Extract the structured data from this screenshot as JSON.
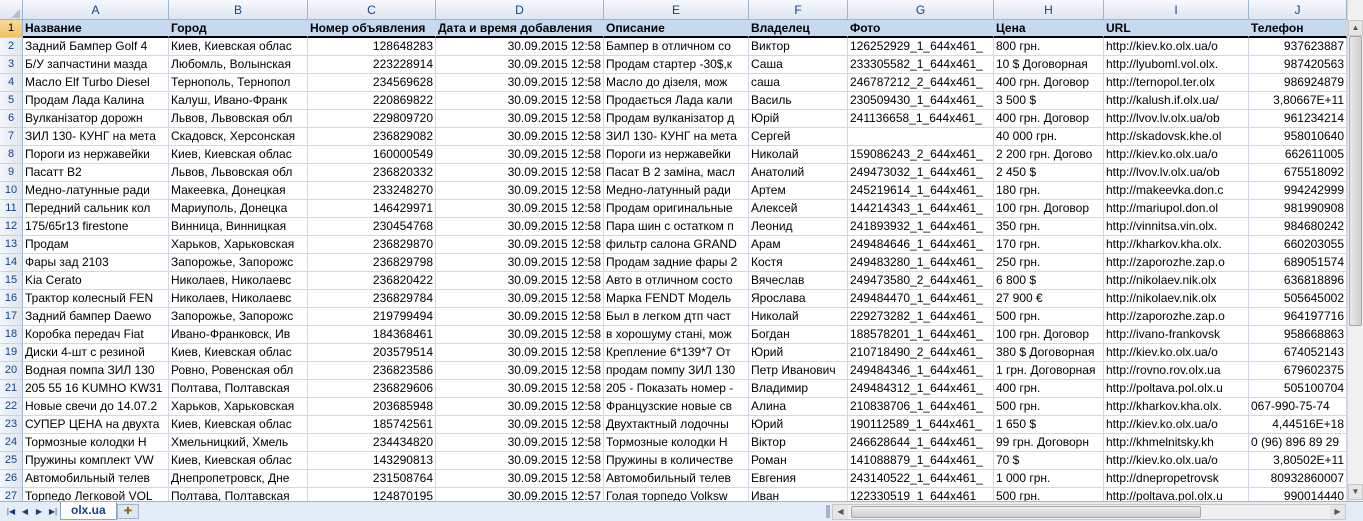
{
  "columns": [
    "A",
    "B",
    "C",
    "D",
    "E",
    "F",
    "G",
    "H",
    "I",
    "J"
  ],
  "headers": [
    "Название",
    "Город",
    "Номер объявления",
    "Дата и время добавления",
    "Описание",
    "Владелец",
    "Фото",
    "Цена",
    "URL",
    "Телефон"
  ],
  "rows": [
    {
      "n": "2",
      "c": [
        "Задний Бампер Golf 4",
        "Киев, Киевская облас",
        "128648283",
        "30.09.2015 12:58",
        "Бампер в отличном со",
        "Виктор",
        "126252929_1_644x461_",
        "800 грн.",
        "http://kiev.ko.olx.ua/o",
        "937623887"
      ]
    },
    {
      "n": "3",
      "c": [
        "Б/У запчастини мазда",
        "Любомль, Волынская",
        "223228914",
        "30.09.2015 12:58",
        "Продам стартер -30$,к",
        "Саша",
        "233305582_1_644x461_",
        "10 $ Договорная",
        "http://lyuboml.vol.olx.",
        "987420563"
      ]
    },
    {
      "n": "4",
      "c": [
        "Масло Elf Turbo Diesel",
        "Тернополь, Тернопол",
        "234569628",
        "30.09.2015 12:58",
        "Масло до дізеля, мож",
        "саша",
        "246787212_2_644x461_",
        "400 грн. Договор",
        "http://ternopol.ter.olx",
        "986924879"
      ]
    },
    {
      "n": "5",
      "c": [
        "Продам Лада Калина",
        "Калуш, Ивано-Франк",
        "220869822",
        "30.09.2015 12:58",
        "Продається Лада кали",
        "Василь",
        "230509430_1_644x461_",
        "3 500 $",
        "http://kalush.if.olx.ua/",
        "3,80667E+11"
      ]
    },
    {
      "n": "6",
      "c": [
        "Вулканізатор дорожн",
        "Львов, Львовская обл",
        "229809720",
        "30.09.2015 12:58",
        "Продам вулканізатор д",
        "Юрій",
        "241136658_1_644x461_",
        "400 грн. Договор",
        "http://lvov.lv.olx.ua/ob",
        "961234214"
      ]
    },
    {
      "n": "7",
      "c": [
        "ЗИЛ 130- КУНГ на мета",
        "Скадовск, Херсонская",
        "236829082",
        "30.09.2015 12:58",
        "ЗИЛ 130- КУНГ на мета",
        "Сергей",
        "",
        "40 000 грн.",
        "http://skadovsk.khe.ol",
        "958010640"
      ]
    },
    {
      "n": "8",
      "c": [
        "Пороги из нержавейки",
        "Киев, Киевская облас",
        "160000549",
        "30.09.2015 12:58",
        "Пороги из нержавейки",
        "Николай",
        "159086243_2_644x461_",
        "2 200 грн. Догово",
        "http://kiev.ko.olx.ua/o",
        "662611005"
      ]
    },
    {
      "n": "9",
      "c": [
        "Пасатт В2",
        "Львов, Львовская обл",
        "236820332",
        "30.09.2015 12:58",
        "Пасат В 2 заміна, масл",
        "Анатолий",
        "249473032_1_644x461_",
        "2 450 $",
        "http://lvov.lv.olx.ua/ob",
        "675518092"
      ]
    },
    {
      "n": "10",
      "c": [
        "Медно-латунные ради",
        "Макеевка, Донецкая",
        "233248270",
        "30.09.2015 12:58",
        "Медно-латунный ради",
        "Артем",
        "245219614_1_644x461_",
        "180 грн.",
        "http://makeevka.don.c",
        "994242999"
      ]
    },
    {
      "n": "11",
      "c": [
        "Передний сальник кол",
        "Мариуполь, Донецка",
        "146429971",
        "30.09.2015 12:58",
        "Продам оригинальные",
        "Алексей",
        "144214343_1_644x461_",
        "100 грн. Договор",
        "http://mariupol.don.ol",
        "981990908"
      ]
    },
    {
      "n": "12",
      "c": [
        "175/65r13 firestone",
        "Винница, Винницкая",
        "230454768",
        "30.09.2015 12:58",
        "Пара шин с остатком п",
        "Леонид",
        "241893932_1_644x461_",
        "350 грн.",
        "http://vinnitsa.vin.olx.",
        "984680242"
      ]
    },
    {
      "n": "13",
      "c": [
        "Продам",
        "Харьков, Харьковская",
        "236829870",
        "30.09.2015 12:58",
        "фильтр салона GRAND",
        "Арам",
        "249484646_1_644x461_",
        "170 грн.",
        "http://kharkov.kha.olx.",
        "660203055"
      ]
    },
    {
      "n": "14",
      "c": [
        "Фары зад 2103",
        "Запорожье, Запорожс",
        "236829798",
        "30.09.2015 12:58",
        "Продам задние фары 2",
        "Костя",
        "249483280_1_644x461_",
        "250 грн.",
        "http://zaporozhe.zap.o",
        "689051574"
      ]
    },
    {
      "n": "15",
      "c": [
        "Kia Cerato",
        "Николаев, Николаевс",
        "236820422",
        "30.09.2015 12:58",
        "Авто в отличном состо",
        "Вячеслав",
        "249473580_2_644x461_",
        "6 800 $",
        "http://nikolaev.nik.olx",
        "636818896"
      ]
    },
    {
      "n": "16",
      "c": [
        "Трактор колесный FEN",
        "Николаев, Николаевс",
        "236829784",
        "30.09.2015 12:58",
        "Марка FENDT Модель",
        "Ярослава",
        "249484470_1_644x461_",
        "27 900 €",
        "http://nikolaev.nik.olx",
        "505645002"
      ]
    },
    {
      "n": "17",
      "c": [
        "Задний бампер Daewo",
        "Запорожье, Запорожс",
        "219799494",
        "30.09.2015 12:58",
        "Был в легком дтп част",
        "Николай",
        "229273282_1_644x461_",
        "500 грн.",
        "http://zaporozhe.zap.o",
        "964197716"
      ]
    },
    {
      "n": "18",
      "c": [
        "Коробка передач Fiat",
        "Ивано-Франковск, Ив",
        "184368461",
        "30.09.2015 12:58",
        "в хорошуму стані, мож",
        "Богдан",
        "188578201_1_644x461_",
        "100 грн. Договор",
        "http://ivano-frankovsk",
        "958668863"
      ]
    },
    {
      "n": "19",
      "c": [
        "Диски 4-шт с резиной",
        "Киев, Киевская облас",
        "203579514",
        "30.09.2015 12:58",
        "Крепление 6*139*7 От",
        "Юрий",
        "210718490_2_644x461_",
        "380 $ Договорная",
        "http://kiev.ko.olx.ua/o",
        "674052143"
      ]
    },
    {
      "n": "20",
      "c": [
        "Водная помпа ЗИЛ 130",
        "Ровно, Ровенская обл",
        "236823586",
        "30.09.2015 12:58",
        "продам помпу ЗИЛ 130",
        "Петр Иванович",
        "249484346_1_644x461_",
        "1 грн. Договорная",
        "http://rovno.rov.olx.ua",
        "679602375"
      ]
    },
    {
      "n": "21",
      "c": [
        "205 55 16 KUMHO KW31",
        "Полтава, Полтавская",
        "236829606",
        "30.09.2015 12:58",
        "205 - Показать номер -",
        "Владимир",
        "249484312_1_644x461_",
        "400 грн.",
        "http://poltava.pol.olx.u",
        "505100704"
      ]
    },
    {
      "n": "22",
      "c": [
        "Новые свечи до 14.07.2",
        "Харьков, Харьковская",
        "203685948",
        "30.09.2015 12:58",
        "Французские новые св",
        "Алина",
        "210838706_1_644x461_",
        "500 грн.",
        "http://kharkov.kha.olx.",
        "067-990-75-74"
      ]
    },
    {
      "n": "23",
      "c": [
        "СУПЕР ЦЕНА на двухта",
        "Киев, Киевская облас",
        "185742561",
        "30.09.2015 12:58",
        "Двухтактный лодочны",
        "Юрий",
        "190112589_1_644x461_",
        "1 650 $",
        "http://kiev.ko.olx.ua/o",
        "4,44516E+18"
      ]
    },
    {
      "n": "24",
      "c": [
        "Тормозные колодки Н",
        "Хмельницкий, Хмель",
        "234434820",
        "30.09.2015 12:58",
        "Тормозные колодки Н",
        "Віктор",
        "246628644_1_644x461_",
        "99 грн. Договорн",
        "http://khmelnitsky.kh",
        "0 (96) 896 89 29"
      ]
    },
    {
      "n": "25",
      "c": [
        "Пружины комплект VW",
        "Киев, Киевская облас",
        "143290813",
        "30.09.2015 12:58",
        "Пружины в количестве",
        "Роман",
        "141088879_1_644x461_",
        "70 $",
        "http://kiev.ko.olx.ua/o",
        "3,80502E+11"
      ]
    },
    {
      "n": "26",
      "c": [
        "Автомобильный телев",
        "Днепропетровск, Дне",
        "231508764",
        "30.09.2015 12:58",
        "Автомобильный телев",
        "Евгения",
        "243140522_1_644x461_",
        "1 000 грн.",
        "http://dnepropetrovsk",
        "80932860007"
      ]
    },
    {
      "n": "27",
      "c": [
        "Торпедо Легковой VOL",
        "Полтава, Полтавская",
        "124870195",
        "30.09.2015 12:57",
        "Голая торпедо Volksw",
        "Иван",
        "122330519_1_644x461_",
        "500 грн.",
        "http://poltava.pol.olx.u",
        "990014440"
      ]
    }
  ],
  "sheet_tab": "olx.ua"
}
